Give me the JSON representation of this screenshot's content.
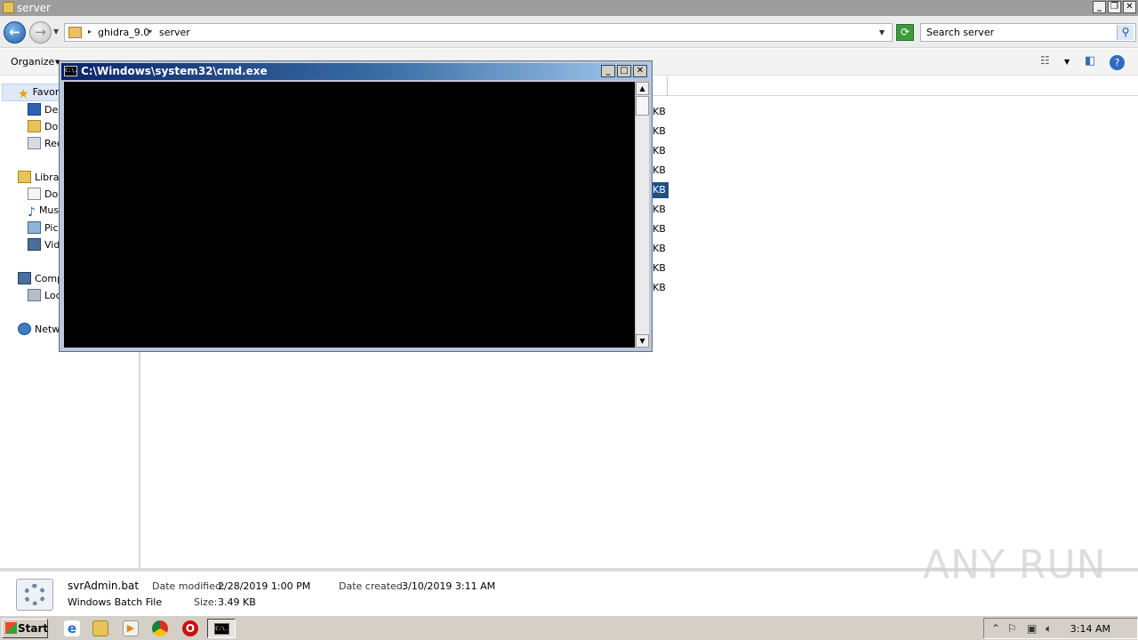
{
  "explorer": {
    "title": "server",
    "breadcrumb": [
      "ghidra_9.0",
      "server"
    ],
    "search_placeholder": "Search server",
    "toolbar": {
      "organize_label": "Organize"
    },
    "nav": {
      "favorites": "Favori",
      "desktop": "Des",
      "downloads": "Dov",
      "recent": "Rec",
      "libraries": "Librar",
      "documents": "Doc",
      "music": "Mus",
      "pictures": "Pict",
      "videos": "Vide",
      "computer": "Comp",
      "local_disk": "Loc",
      "network": "Netw"
    },
    "size_fragments": [
      "KB",
      "KB",
      "KB",
      "KB",
      "KB",
      "KB",
      "KB",
      "KB",
      "KB",
      "KB"
    ],
    "selected_row_index": 4,
    "details": {
      "filename": "svrAdmin.bat",
      "filetype": "Windows Batch File",
      "date_modified_label": "Date modified:",
      "date_modified": "2/28/2019 1:00 PM",
      "date_created_label": "Date created:",
      "date_created": "3/10/2019 3:11 AM",
      "size_label": "Size:",
      "size": "3.49 KB"
    }
  },
  "cmd": {
    "title": "C:\\Windows\\system32\\cmd.exe",
    "icon_text": "C:\\."
  },
  "taskbar": {
    "start_label": "Start",
    "clock": "3:14 AM",
    "active_icon_text": "C:\\."
  },
  "watermark": "ANY RUN",
  "colors": {
    "selection": "#1f4e8c",
    "cmd_title_start": "#0a246a",
    "cmd_title_end": "#a6caf0"
  }
}
